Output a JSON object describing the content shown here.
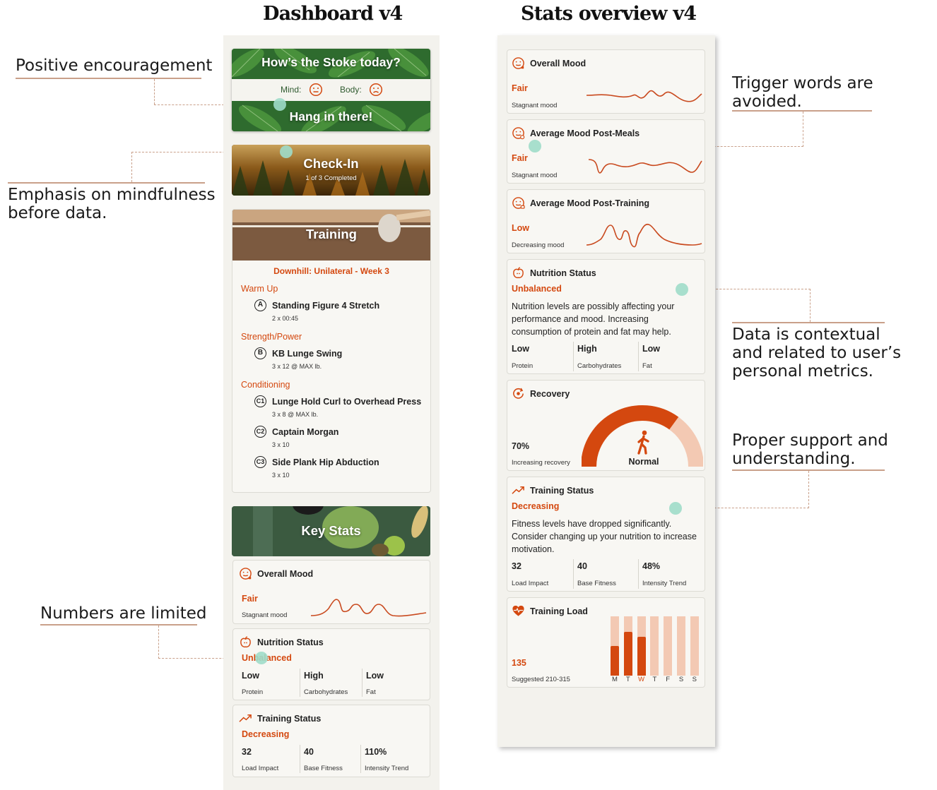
{
  "headings": {
    "left": "Dashboard v4",
    "right": "Stats overview v4"
  },
  "annotations": {
    "positive": "Positive encouragement",
    "mindfulness_1": "Emphasis on mindfulness",
    "mindfulness_2": "before data.",
    "numbers": "Numbers are limited",
    "trigger_1": "Trigger words are",
    "trigger_2": "avoided.",
    "contextual_1": "Data is contextual",
    "contextual_2": "and related to user’s",
    "contextual_3": "personal metrics.",
    "support_1": "Proper support and",
    "support_2": "understanding."
  },
  "dashboard": {
    "stoke": {
      "question": "How’s the Stoke today?",
      "mind_label": "Mind:",
      "body_label": "Body:",
      "message": "Hang in there!"
    },
    "checkin": {
      "title": "Check-In",
      "progress": "1 of 3 Completed"
    },
    "training": {
      "title": "Training",
      "workout": "Downhill: Unilateral - Week 3",
      "sections": [
        {
          "name": "Warm Up",
          "exercises": [
            {
              "letter": "A",
              "name": "Standing Figure 4 Stretch",
              "sets": "2 x 00:45"
            }
          ]
        },
        {
          "name": "Strength/Power",
          "exercises": [
            {
              "letter": "B",
              "name": "KB Lunge Swing",
              "sets": "3 x 12 @ MAX lb."
            }
          ]
        },
        {
          "name": "Conditioning",
          "exercises": [
            {
              "letter": "C1",
              "name": "Lunge Hold Curl to Overhead Press",
              "sets": "3 x 8 @ MAX lb."
            },
            {
              "letter": "C2",
              "name": "Captain Morgan",
              "sets": "3 x 10"
            },
            {
              "letter": "C3",
              "name": "Side Plank Hip Abduction",
              "sets": "3 x 10"
            }
          ]
        }
      ]
    },
    "keystats": {
      "title": "Key Stats"
    },
    "mood": {
      "title": "Overall Mood",
      "status": "Fair",
      "note": "Stagnant mood"
    },
    "nutrition": {
      "title": "Nutrition Status",
      "status": "Unbalanced",
      "macros": [
        {
          "level": "Low",
          "name": "Protein"
        },
        {
          "level": "High",
          "name": "Carbohydrates"
        },
        {
          "level": "Low",
          "name": "Fat"
        }
      ]
    },
    "training_status": {
      "title": "Training Status",
      "status": "Decreasing",
      "metrics": [
        {
          "value": "32",
          "name": "Load Impact"
        },
        {
          "value": "40",
          "name": "Base Fitness"
        },
        {
          "value": "110%",
          "name": "Intensity Trend"
        }
      ]
    }
  },
  "stats": {
    "overall_mood": {
      "title": "Overall Mood",
      "status": "Fair",
      "note": "Stagnant mood"
    },
    "post_meals": {
      "title": "Average Mood Post-Meals",
      "status": "Fair",
      "note": "Stagnant mood"
    },
    "post_training": {
      "title": "Average Mood Post-Training",
      "status": "Low",
      "note": "Decreasing mood"
    },
    "nutrition": {
      "title": "Nutrition Status",
      "status": "Unbalanced",
      "description": "Nutrition levels are possibly affecting your performance and mood. Increasing consumption of protein and fat may help.",
      "macros": [
        {
          "level": "Low",
          "name": "Protein"
        },
        {
          "level": "High",
          "name": "Carbohydrates"
        },
        {
          "level": "Low",
          "name": "Fat"
        }
      ]
    },
    "recovery": {
      "title": "Recovery",
      "value": "70%",
      "note": "Increasing recovery",
      "gauge_label": "Normal",
      "gauge_fill": 0.7
    },
    "training_status": {
      "title": "Training Status",
      "status": "Decreasing",
      "description": "Fitness levels have dropped significantly. Consider changing up your nutrition to increase motivation.",
      "metrics": [
        {
          "value": "32",
          "name": "Load Impact"
        },
        {
          "value": "40",
          "name": "Base Fitness"
        },
        {
          "value": "48%",
          "name": "Intensity Trend"
        }
      ]
    },
    "training_load": {
      "title": "Training Load",
      "value": "135",
      "note": "Suggested 210-315",
      "days": [
        "M",
        "T",
        "W",
        "T",
        "F",
        "S",
        "S"
      ],
      "current_day_index": 2,
      "daily_fill": [
        0.5,
        0.74,
        0.66,
        0,
        0,
        0,
        0
      ]
    }
  },
  "colors": {
    "accent": "#d4480f",
    "accent_light": "#f3c9b3",
    "mint": "#9fdcc9",
    "background": "#f3f2ed",
    "card": "#f8f7f3"
  }
}
